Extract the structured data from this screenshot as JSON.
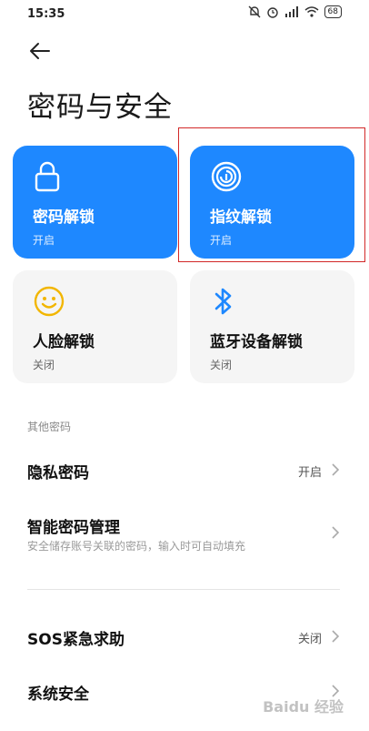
{
  "status_bar": {
    "time": "15:35",
    "battery": "68"
  },
  "header": {
    "title": "密码与安全"
  },
  "cards": [
    {
      "title": "密码解锁",
      "status": "开启",
      "icon": "lock-icon"
    },
    {
      "title": "指纹解锁",
      "status": "开启",
      "icon": "fingerprint-icon"
    },
    {
      "title": "人脸解锁",
      "status": "关闭",
      "icon": "face-icon"
    },
    {
      "title": "蓝牙设备解锁",
      "status": "关闭",
      "icon": "bluetooth-icon"
    }
  ],
  "section": {
    "label": "其他密码"
  },
  "rows": [
    {
      "title": "隐私密码",
      "value": "开启"
    },
    {
      "title": "智能密码管理",
      "desc": "安全储存账号关联的密码，输入时可自动填充"
    },
    {
      "title": "SOS紧急求助",
      "value": "关闭"
    },
    {
      "title": "系统安全"
    }
  ],
  "watermark": "Baidu 经验",
  "colors": {
    "accent": "#1e88ff",
    "highlight": "#d22828",
    "face_icon": "#f2b600"
  }
}
